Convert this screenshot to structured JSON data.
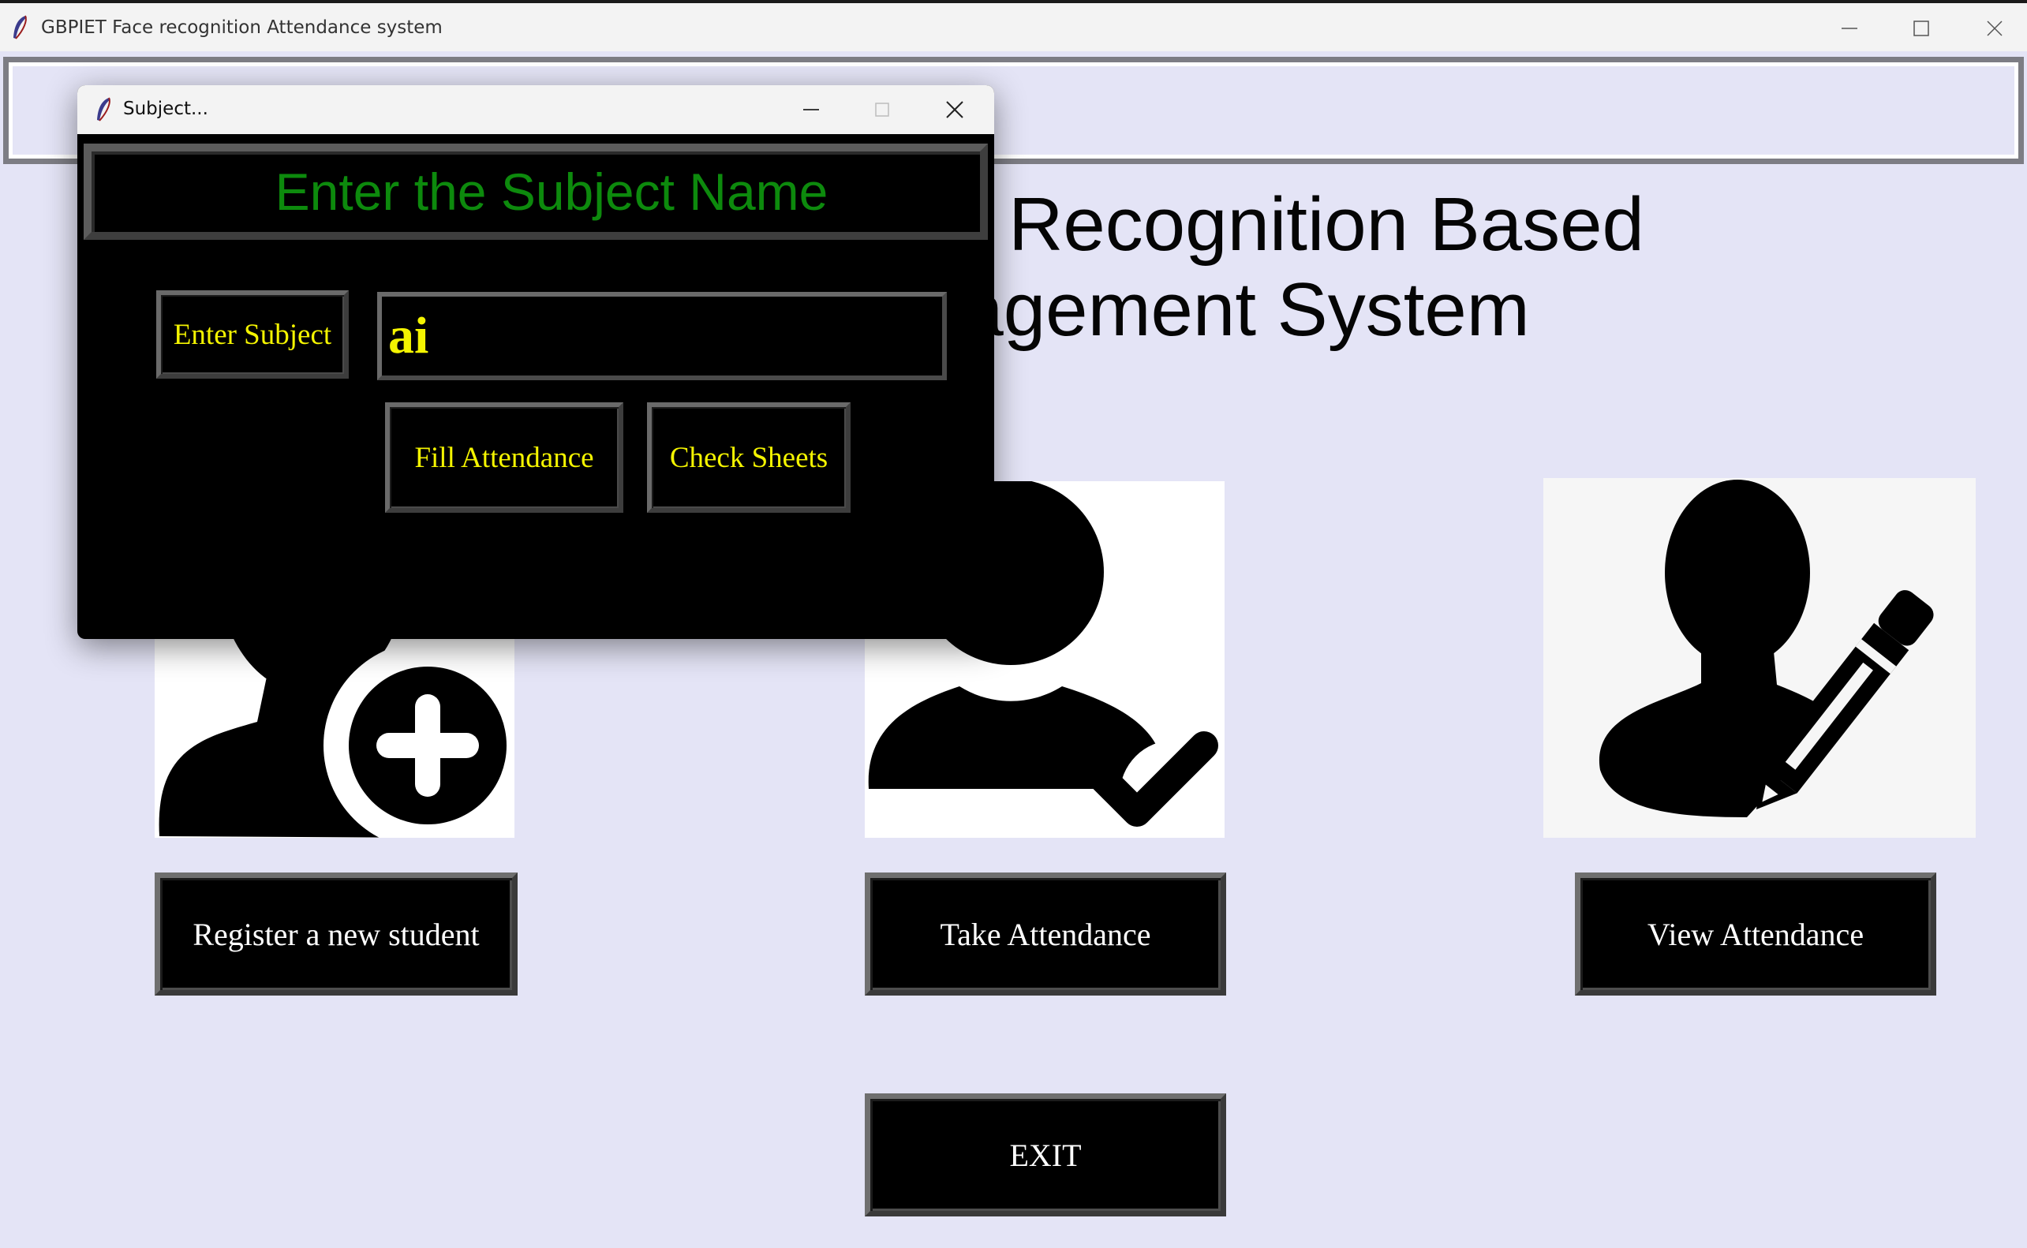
{
  "main_window": {
    "title": "GBPIET Face recognition Attendance system",
    "title_fragments": [
      "ce Recognition Based",
      "nagement System"
    ],
    "buttons": {
      "register": "Register a new student",
      "take": "Take Attendance",
      "view": "View Attendance",
      "exit": "EXIT"
    },
    "icons": [
      "add-user-icon",
      "user-check-icon",
      "user-edit-icon"
    ]
  },
  "dialog": {
    "title": "Subject...",
    "heading": "Enter the Subject Name",
    "enter_subject_label": "Enter Subject",
    "subject_value": "ai",
    "fill_attendance": "Fill Attendance",
    "check_sheets": "Check Sheets"
  },
  "colors": {
    "background": "#e4e4f6",
    "button_bg": "#000000",
    "button_text": "#ffffff",
    "dialog_text": "#f4f400",
    "heading": "#0d8a0d"
  }
}
